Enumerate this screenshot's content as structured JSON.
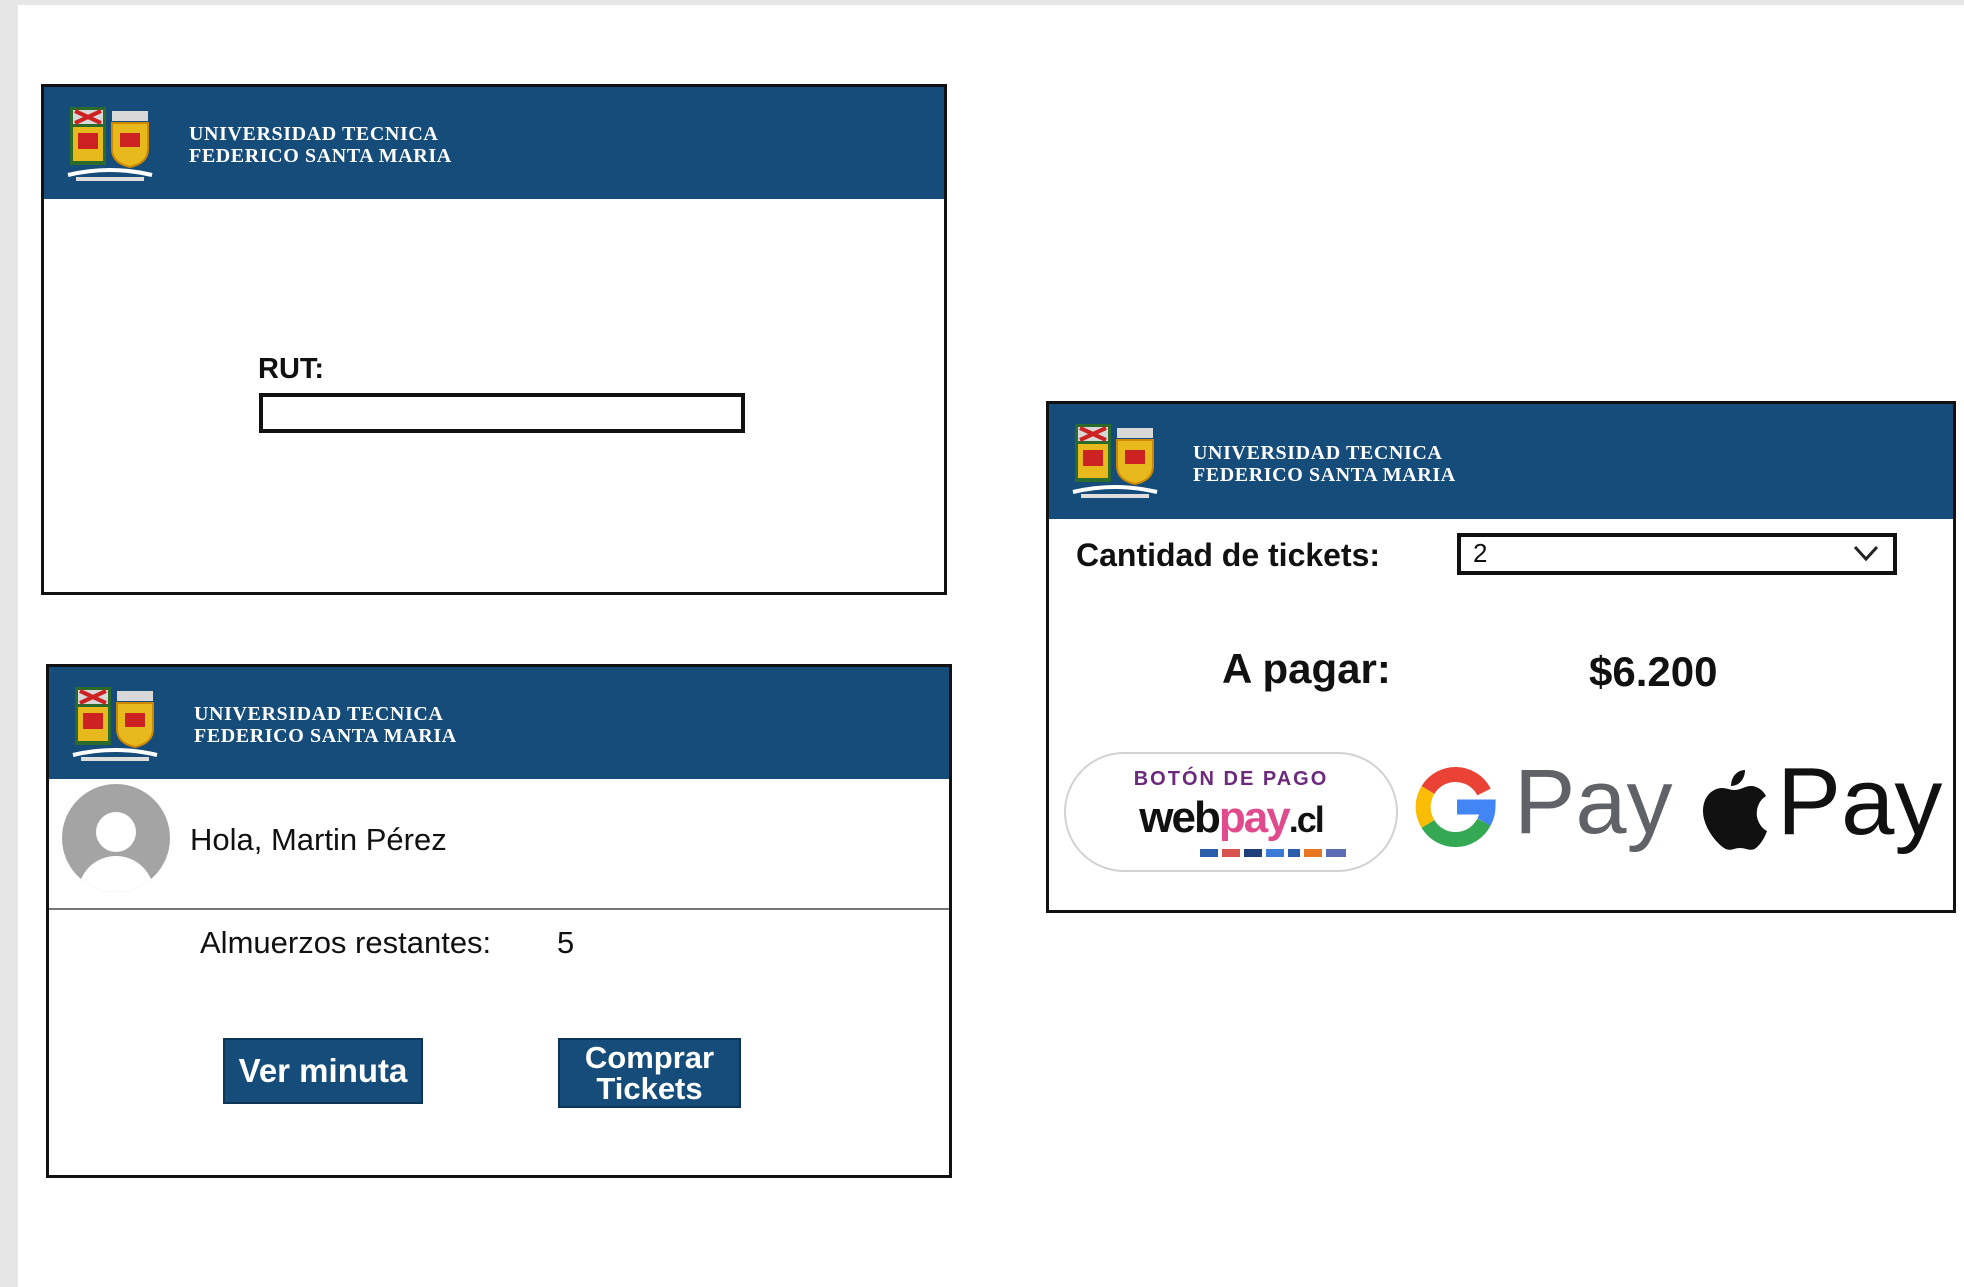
{
  "university": {
    "line1": "UNIVERSIDAD TECNICA",
    "line2": "FEDERICO SANTA MARIA"
  },
  "login": {
    "rut_label": "RUT:",
    "rut_value": ""
  },
  "home": {
    "greeting": "Hola, Martin Pérez",
    "lunches_label": "Almuerzos restantes:",
    "lunches_value": "5",
    "view_menu_label": "Ver minuta",
    "buy_tickets_label": "Comprar\nTickets"
  },
  "purchase": {
    "quantity_label": "Cantidad de tickets:",
    "quantity_value": "2",
    "to_pay_label": "A pagar:",
    "amount": "$6.200",
    "webpay": {
      "top": "BOTÓN DE PAGO",
      "web": "web",
      "pay": "pay",
      "cl": ".cl"
    },
    "google_pay": "Pay",
    "apple_pay": "Pay"
  },
  "colors": {
    "header": "#154c7a",
    "webpay_accent": "#e14a8c",
    "webpay_title": "#6b2a7b"
  },
  "icons": [
    "utfsm-logo-icon",
    "user-avatar-icon",
    "chevron-down-icon",
    "google-g-icon",
    "apple-icon",
    "card-brands-icon"
  ]
}
